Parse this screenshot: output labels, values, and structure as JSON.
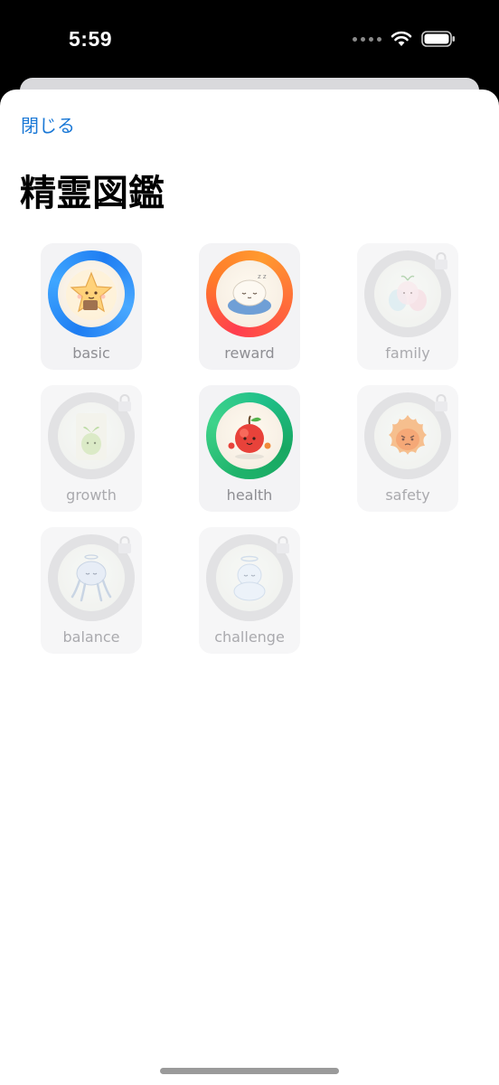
{
  "status_bar": {
    "time": "5:59"
  },
  "sheet": {
    "close_label": "閉じる",
    "title": "精霊図鑑"
  },
  "spirits": [
    {
      "label": "basic",
      "unlocked": true,
      "ring": "blue",
      "icon": "star-spirit-icon"
    },
    {
      "label": "reward",
      "unlocked": true,
      "ring": "orange",
      "icon": "sleepy-cloud-spirit-icon"
    },
    {
      "label": "family",
      "unlocked": false,
      "ring": "gray",
      "icon": "spirit-family-icon"
    },
    {
      "label": "growth",
      "unlocked": false,
      "ring": "gray",
      "icon": "sprout-spirit-icon"
    },
    {
      "label": "health",
      "unlocked": true,
      "ring": "green",
      "icon": "apple-spirit-icon"
    },
    {
      "label": "safety",
      "unlocked": false,
      "ring": "gray",
      "icon": "flame-spirit-icon"
    },
    {
      "label": "balance",
      "unlocked": false,
      "ring": "gray",
      "icon": "jellyfish-spirit-icon"
    },
    {
      "label": "challenge",
      "unlocked": false,
      "ring": "gray",
      "icon": "halo-spirit-icon"
    }
  ],
  "colors": {
    "link": "#1a78d6",
    "ring_blue": "#2f8ef7",
    "ring_orange": "#ff6a3a",
    "ring_green": "#2fc77c",
    "locked_ring": "#d9d9dc",
    "label": "#8e8e93"
  }
}
